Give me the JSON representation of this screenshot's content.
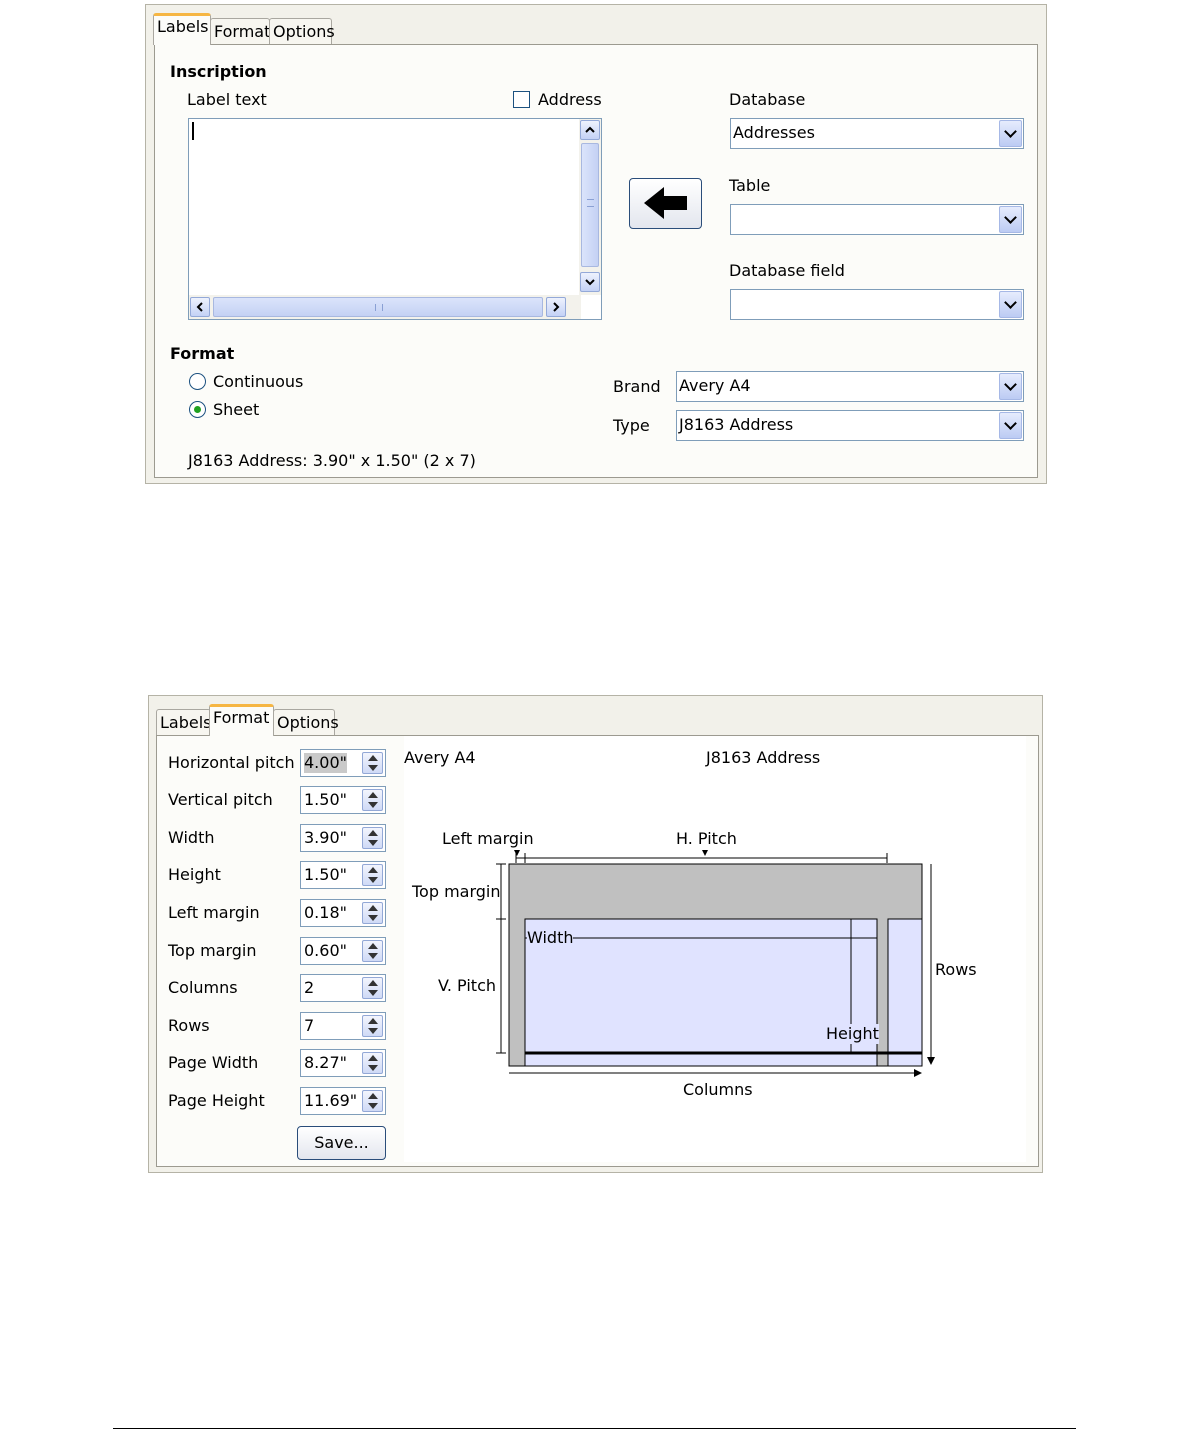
{
  "dialog1": {
    "tabs": [
      "Labels",
      "Format",
      "Options"
    ],
    "inscription": {
      "heading": "Inscription",
      "label_text": "Label text",
      "address_checkbox": {
        "label": "Address",
        "checked": false
      },
      "label_text_value": ""
    },
    "database": {
      "label": "Database",
      "value": "Addresses"
    },
    "table": {
      "label": "Table",
      "value": ""
    },
    "database_field": {
      "label": "Database field",
      "value": ""
    },
    "insert_button_icon": "left-arrow-icon",
    "format": {
      "heading": "Format",
      "options": [
        {
          "label": "Continuous",
          "selected": false
        },
        {
          "label": "Sheet",
          "selected": true
        }
      ]
    },
    "brand": {
      "label": "Brand",
      "value": "Avery A4"
    },
    "type": {
      "label": "Type",
      "value": "J8163 Address"
    },
    "summary": "J8163 Address: 3.90\" x 1.50\" (2 x 7)"
  },
  "dialog2": {
    "tabs": [
      "Labels",
      "Format",
      "Options"
    ],
    "fields": [
      {
        "label": "Horizontal pitch",
        "value": "4.00\""
      },
      {
        "label": "Vertical pitch",
        "value": "1.50\""
      },
      {
        "label": "Width",
        "value": "3.90\""
      },
      {
        "label": "Height",
        "value": "1.50\""
      },
      {
        "label": "Left margin",
        "value": "0.18\""
      },
      {
        "label": "Top margin",
        "value": "0.60\""
      },
      {
        "label": "Columns",
        "value": "2"
      },
      {
        "label": "Rows",
        "value": "7"
      },
      {
        "label": "Page Width",
        "value": "8.27\""
      },
      {
        "label": "Page Height",
        "value": "11.69\""
      }
    ],
    "save_button": "Save...",
    "preview": {
      "brand": "Avery A4",
      "type": "J8163 Address",
      "left_margin": "Left margin",
      "h_pitch": "H. Pitch",
      "top_margin": "Top margin",
      "width": "Width",
      "v_pitch": "V. Pitch",
      "rows": "Rows",
      "height": "Height",
      "columns": "Columns"
    }
  },
  "colors": {
    "tab_accent": "#f6b643",
    "preview_label_fill": "#e0e3ff",
    "preview_margin_fill": "#c0c0c0"
  }
}
